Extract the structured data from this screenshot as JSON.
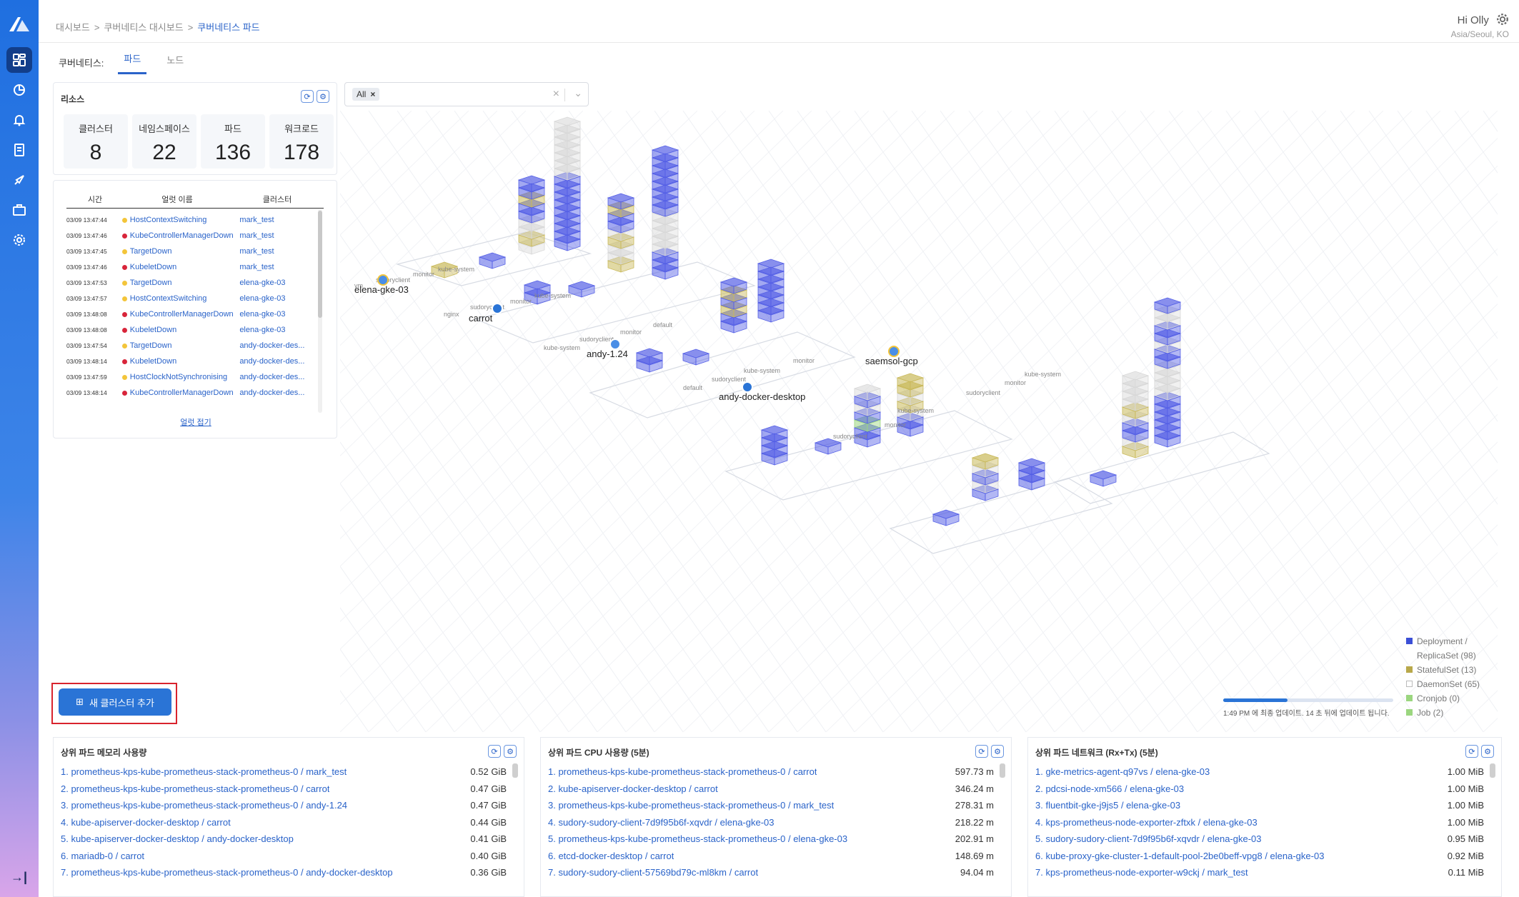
{
  "breadcrumb": [
    "대시보드",
    "쿠버네티스 대시보드",
    "쿠버네티스 파드"
  ],
  "user": {
    "greeting": "Hi Olly",
    "timezone": "Asia/Seoul, KO"
  },
  "tabs": {
    "prefix": "쿠버네티스:",
    "items": [
      "파드",
      "노드"
    ],
    "active": "파드"
  },
  "resources": {
    "title": "리소스",
    "stats": [
      {
        "label": "클러스터",
        "value": "8"
      },
      {
        "label": "네임스페이스",
        "value": "22"
      },
      {
        "label": "파드",
        "value": "136"
      },
      {
        "label": "워크로드",
        "value": "178"
      }
    ]
  },
  "alerts": {
    "columns": [
      "시간",
      "얼럿 이름",
      "클러스터"
    ],
    "rows": [
      {
        "time": "03/09 13:47:44",
        "level": "warning",
        "name": "HostContextSwitching",
        "cluster": "mark_test"
      },
      {
        "time": "03/09 13:47:46",
        "level": "critical",
        "name": "KubeControllerManagerDown",
        "cluster": "mark_test"
      },
      {
        "time": "03/09 13:47:45",
        "level": "warning",
        "name": "TargetDown",
        "cluster": "mark_test"
      },
      {
        "time": "03/09 13:47:46",
        "level": "critical",
        "name": "KubeletDown",
        "cluster": "mark_test"
      },
      {
        "time": "03/09 13:47:53",
        "level": "warning",
        "name": "TargetDown",
        "cluster": "elena-gke-03"
      },
      {
        "time": "03/09 13:47:57",
        "level": "warning",
        "name": "HostContextSwitching",
        "cluster": "elena-gke-03"
      },
      {
        "time": "03/09 13:48:08",
        "level": "critical",
        "name": "KubeControllerManagerDown",
        "cluster": "elena-gke-03"
      },
      {
        "time": "03/09 13:48:08",
        "level": "critical",
        "name": "KubeletDown",
        "cluster": "elena-gke-03"
      },
      {
        "time": "03/09 13:47:54",
        "level": "warning",
        "name": "TargetDown",
        "cluster": "andy-docker-des..."
      },
      {
        "time": "03/09 13:48:14",
        "level": "critical",
        "name": "KubeletDown",
        "cluster": "andy-docker-des..."
      },
      {
        "time": "03/09 13:47:59",
        "level": "warning",
        "name": "HostClockNotSynchronising",
        "cluster": "andy-docker-des..."
      },
      {
        "time": "03/09 13:48:14",
        "level": "critical",
        "name": "KubeControllerManagerDown",
        "cluster": "andy-docker-des..."
      }
    ],
    "close_label": "얼럿 접기"
  },
  "filter": {
    "chip": "All"
  },
  "clusters": [
    {
      "name": "mark_test",
      "icon": "gcp-cloud-icon",
      "namespaces": [
        "vm",
        "sudoryclient",
        "monitor",
        "kube-system"
      ]
    },
    {
      "name": "elena-gke-03",
      "icon": "gcp-cloud-icon",
      "namespaces": [
        "nginx",
        "sudoryclient",
        "monitor",
        "kube-system"
      ]
    },
    {
      "name": "carrot",
      "icon": "docker-icon",
      "namespaces": [
        "kube-system",
        "sudoryclient",
        "monitor",
        "default"
      ]
    },
    {
      "name": "andy-1.24",
      "icon": "cloud-icon",
      "namespaces": [
        "default",
        "sudoryclient",
        "kube-system",
        "monitor"
      ]
    },
    {
      "name": "andy-docker-desktop",
      "icon": "docker-icon",
      "namespaces": [
        "sudoryclient",
        "monitor",
        "kube-system"
      ]
    },
    {
      "name": "saemsol-gcp",
      "icon": "gcp-cloud-icon",
      "namespaces": [
        "sudoryclient",
        "monitor",
        "kube-system"
      ]
    }
  ],
  "add_cluster": {
    "label": "새 클러스터 추가"
  },
  "legend": [
    {
      "label": "Deployment / ReplicaSet (98)",
      "color": "#3b4fd6"
    },
    {
      "label": "StatefulSet (13)",
      "color": "#b8a84a"
    },
    {
      "label": "DaemonSet (65)",
      "color": "#ffffff"
    },
    {
      "label": "Cronjob (0)",
      "color": "#9bd67f"
    },
    {
      "label": "Job (2)",
      "color": "#9bd67f"
    }
  ],
  "update": {
    "text": "1:49 PM 에 최종 업데이트. 14 초 뒤에 업데이트 됩니다.",
    "progress": 0.38
  },
  "memory": {
    "title": "상위 파드 메모리 사용량",
    "rows": [
      {
        "name": "1. prometheus-kps-kube-prometheus-stack-prometheus-0 / mark_test",
        "value": "0.52 GiB"
      },
      {
        "name": "2. prometheus-kps-kube-prometheus-stack-prometheus-0 / carrot",
        "value": "0.47 GiB"
      },
      {
        "name": "3. prometheus-kps-kube-prometheus-stack-prometheus-0 / andy-1.24",
        "value": "0.47 GiB"
      },
      {
        "name": "4. kube-apiserver-docker-desktop / carrot",
        "value": "0.44 GiB"
      },
      {
        "name": "5. kube-apiserver-docker-desktop / andy-docker-desktop",
        "value": "0.41 GiB"
      },
      {
        "name": "6. mariadb-0 / carrot",
        "value": "0.40 GiB"
      },
      {
        "name": "7. prometheus-kps-kube-prometheus-stack-prometheus-0 / andy-docker-desktop",
        "value": "0.36 GiB"
      }
    ]
  },
  "cpu": {
    "title": "상위 파드 CPU 사용량 (5분)",
    "rows": [
      {
        "name": "1. prometheus-kps-kube-prometheus-stack-prometheus-0 / carrot",
        "value": "597.73 m"
      },
      {
        "name": "2. kube-apiserver-docker-desktop / carrot",
        "value": "346.24 m"
      },
      {
        "name": "3. prometheus-kps-kube-prometheus-stack-prometheus-0 / mark_test",
        "value": "278.31 m"
      },
      {
        "name": "4. sudory-sudory-client-7d9f95b6f-xqvdr / elena-gke-03",
        "value": "218.22 m"
      },
      {
        "name": "5. prometheus-kps-kube-prometheus-stack-prometheus-0 / elena-gke-03",
        "value": "202.91 m"
      },
      {
        "name": "6. etcd-docker-desktop / carrot",
        "value": "148.69 m"
      },
      {
        "name": "7. sudory-sudory-client-57569bd79c-ml8km / carrot",
        "value": "94.04 m"
      }
    ]
  },
  "network": {
    "title": "상위 파드 네트워크 (Rx+Tx) (5분)",
    "rows": [
      {
        "name": "1. gke-metrics-agent-q97vs / elena-gke-03",
        "value": "1.00 MiB"
      },
      {
        "name": "2. pdcsi-node-xm566 / elena-gke-03",
        "value": "1.00 MiB"
      },
      {
        "name": "3. fluentbit-gke-j9js5 / elena-gke-03",
        "value": "1.00 MiB"
      },
      {
        "name": "4. kps-prometheus-node-exporter-zftxk / elena-gke-03",
        "value": "1.00 MiB"
      },
      {
        "name": "5. sudory-sudory-client-7d9f95b6f-xqvdr / elena-gke-03",
        "value": "0.95 MiB"
      },
      {
        "name": "6. kube-proxy-gke-cluster-1-default-pool-2be0beff-vpg8 / elena-gke-03",
        "value": "0.92 MiB"
      },
      {
        "name": "7. kps-prometheus-node-exporter-w9ckj / mark_test",
        "value": "0.11 MiB"
      }
    ]
  }
}
